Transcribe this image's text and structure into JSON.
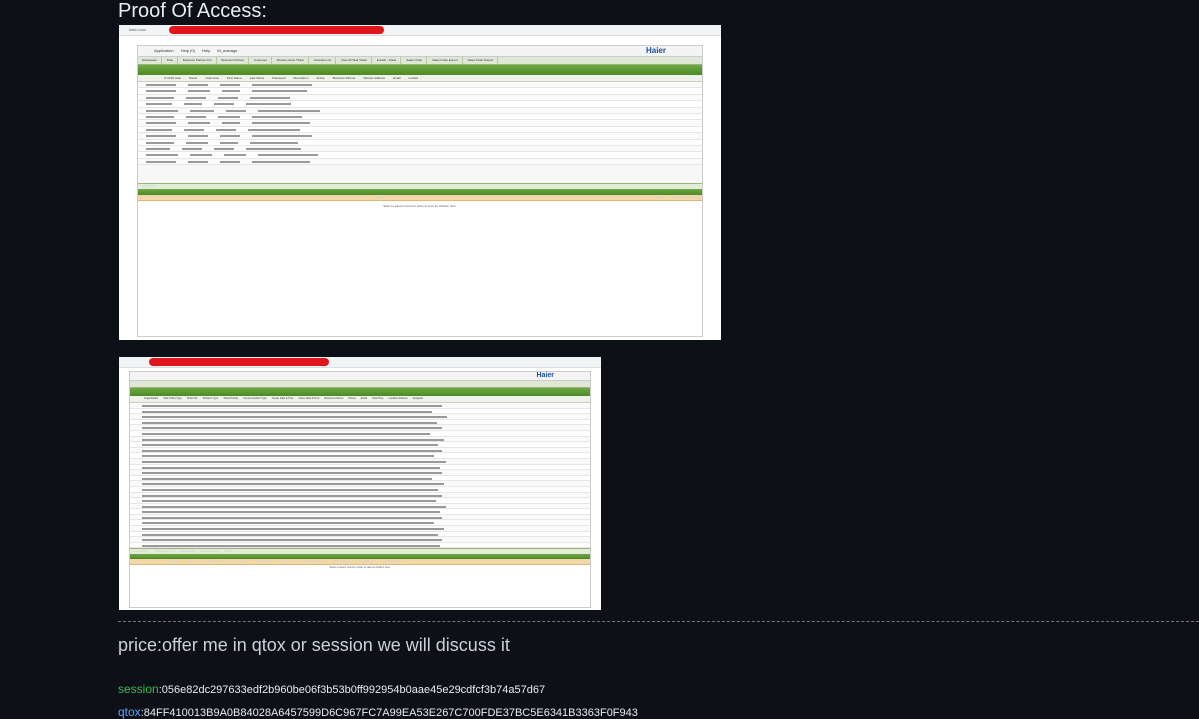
{
  "heading": "Proof Of Access:",
  "screenshot1": {
    "url_fragment": "haier.com",
    "logo": "Haier",
    "toolbar": [
      "Application",
      "Help (0)",
      "Help",
      "fd_manage"
    ],
    "tabs": [
      "Workspace",
      "Role",
      "Business Partner Info",
      "Business Partner",
      "Customer",
      "Review Close Ticket",
      "Activities List",
      "View All Task Ticket",
      "Emails - Ticket",
      "Sales Order",
      "Sales Order Export",
      "Sales Order Report"
    ],
    "headers": [
      "Is Child User",
      "Name",
      "Username",
      "First Name",
      "Last Name",
      "Password",
      "Description",
      "Active",
      "Business Partner",
      "Partner Address",
      "Email",
      "Locked"
    ],
    "subtab": "User Roles",
    "sub_header": "Role",
    "sub_active": "Active",
    "sub_role": "Role Administrator",
    "empty_message": "Select a parent record in order to view its children here."
  },
  "screenshot2": {
    "logo": "Haier",
    "headers": [
      "Organization",
      "Task Ticket Type",
      "Ticket No.",
      "Problem Type",
      "Ticket Priority",
      "Communication Type",
      "Create Date & Time",
      "Close Date & Time",
      "Business Partner",
      "Phone",
      "Email",
      "Total Time",
      "Location Address",
      "Assigned"
    ],
    "subtabs": [
      "Ticket Activity",
      "Ticket Assignment",
      "Escalated By",
      "Escalation Logs",
      "Ref Info"
    ],
    "sub_headers": [
      "Task ID",
      "Activity",
      "Activity Type",
      "Activity Status",
      "Speed Time",
      "Progress %",
      "Notification Count",
      "Work Completed",
      "Assigned to",
      "Notify Customer"
    ],
    "empty_message": "Select a parent record in order to view its children here."
  },
  "price_text": "price:offer me in qtox or session we will discuss it",
  "session": {
    "label": "session",
    "value": ":056e82dc297633edf2b960be06f3b53b0ff992954b0aae45e29cdfcf3b74a57d67"
  },
  "qtox": {
    "label": "qtox",
    "value": ":84FF410013B9A0B84028A6457599D6C967FC7A99EA53E267C700FDE37BC5E6341B3363F0F943"
  },
  "colors": {
    "background": "#0d1117",
    "session_label": "#3fb950",
    "qtox_label": "#58a6ff",
    "redaction": "#e0161c",
    "app_green": "#4c8a27"
  }
}
